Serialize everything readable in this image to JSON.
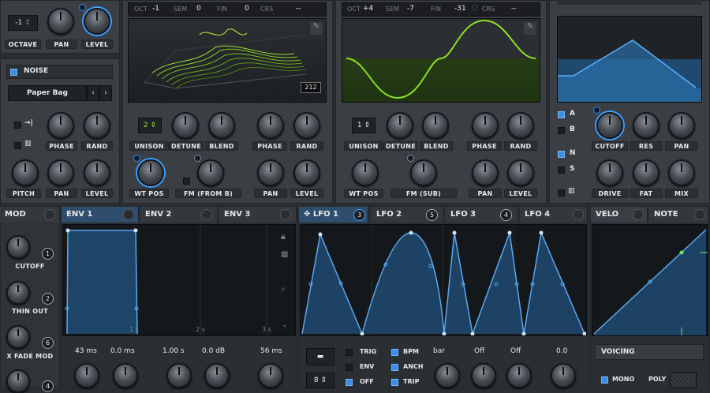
{
  "osc_left": {
    "octave": "-1",
    "labels": {
      "octave": "OCTAVE",
      "pan": "PAN",
      "level": "LEVEL"
    }
  },
  "noise": {
    "title": "NOISE",
    "preset": "Paper Bag",
    "labels": {
      "phase": "PHASE",
      "rand": "RAND",
      "pitch": "PITCH",
      "pan": "PAN",
      "level": "LEVEL"
    }
  },
  "osc_a": {
    "oct_label": "OCT",
    "oct": "-1",
    "sem_label": "SEM",
    "sem": "0",
    "fin_label": "FIN",
    "fin": "0",
    "crs_label": "CRS",
    "crs": "--",
    "frame": "212",
    "unison": "2",
    "labels": {
      "unison": "UNISON",
      "detune": "DETUNE",
      "blend": "BLEND",
      "phase": "PHASE",
      "rand": "RAND",
      "wtpos": "WT POS",
      "fm": "FM (FROM B)",
      "pan": "PAN",
      "level": "LEVEL"
    }
  },
  "osc_b": {
    "oct_label": "OCT",
    "oct": "+4",
    "sem_label": "SEM",
    "sem": "-7",
    "fin_label": "FIN",
    "fin": "-31",
    "crs_label": "CRS",
    "crs": "--",
    "unison": "1",
    "labels": {
      "unison": "UNISON",
      "detune": "DETUNE",
      "blend": "BLEND",
      "phase": "PHASE",
      "rand": "RAND",
      "wtpos": "WT POS",
      "fm": "FM (SUB)",
      "pan": "PAN",
      "level": "LEVEL"
    }
  },
  "filter": {
    "a": "A",
    "b": "B",
    "n": "N",
    "s": "S",
    "labels": {
      "cutoff": "CUTOFF",
      "res": "RES",
      "pan": "PAN",
      "drive": "DRIVE",
      "fat": "FAT",
      "mix": "MIX"
    }
  },
  "mod": {
    "title": "MOD",
    "items": [
      {
        "label": "CUTOFF",
        "num": "1"
      },
      {
        "label": "THIN OUT",
        "num": "2"
      },
      {
        "label": "X FADE MOD",
        "num": "6"
      },
      {
        "label": "",
        "num": "4"
      }
    ]
  },
  "env_tabs": [
    "ENV 1",
    "ENV 2",
    "ENV 3"
  ],
  "env": {
    "times": [
      "1 s",
      "2 s",
      "3 s"
    ],
    "values": [
      "43 ms",
      "0.0 ms",
      "1.00 s",
      "0.0 dB",
      "56 ms"
    ]
  },
  "lfo_tabs": [
    {
      "label": "LFO 1",
      "num": "3"
    },
    {
      "label": "LFO 2",
      "num": "5"
    },
    {
      "label": "LFO 3",
      "num": "4"
    },
    {
      "label": "LFO 4",
      "num": ""
    }
  ],
  "lfo": {
    "trig": "TRIG",
    "env": "ENV",
    "off": "OFF",
    "bpm": "BPM",
    "anch": "ANCH",
    "trip": "TRIP",
    "rate": "bar",
    "v1": "Off",
    "v2": "Off",
    "v3": "0.0",
    "grid": "8"
  },
  "velo_tabs": [
    "VELO",
    "NOTE"
  ],
  "voicing": {
    "title": "VOICING",
    "mono": "MONO",
    "poly": "POLY"
  }
}
